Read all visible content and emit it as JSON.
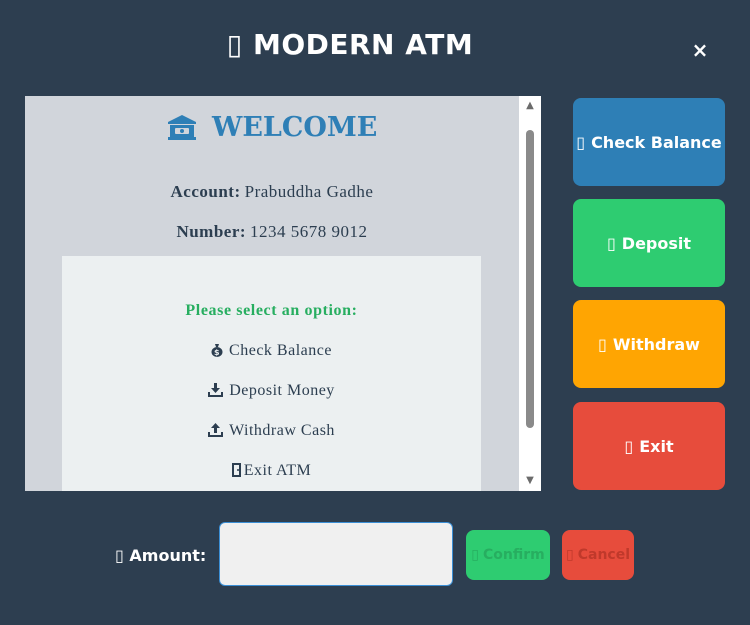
{
  "header": {
    "title": "▯ MODERN ATM",
    "close_label": "×"
  },
  "screen": {
    "welcome": "WELCOME",
    "account_label": "Account:",
    "account_value": "Prabuddha Gadhe",
    "number_label": "Number:",
    "number_value": "1234 5678 9012",
    "prompt": "Please select an option:",
    "options": [
      {
        "icon": "money-bag-icon",
        "label": "Check Balance"
      },
      {
        "icon": "download-icon",
        "label": "Deposit Money"
      },
      {
        "icon": "upload-icon",
        "label": "Withdraw Cash"
      },
      {
        "icon": "door-icon",
        "label": "Exit ATM"
      }
    ]
  },
  "side_buttons": [
    {
      "glyph": "▯",
      "label": "Check Balance",
      "color": "#2e7fb6"
    },
    {
      "glyph": "▯",
      "label": "Deposit",
      "color": "#2ecc71"
    },
    {
      "glyph": "▯",
      "label": "Withdraw",
      "color": "#ffa502"
    },
    {
      "glyph": "▯",
      "label": "Exit",
      "color": "#e74c3c"
    }
  ],
  "amount": {
    "glyph": "▯",
    "label": "Amount:",
    "value": "",
    "placeholder": ""
  },
  "confirm": {
    "glyph": "▯",
    "label": "Confirm",
    "color": "#2ecc71"
  },
  "cancel": {
    "glyph": "▯",
    "label": "Cancel",
    "color": "#e74c3c"
  },
  "colors": {
    "background": "#2d3e50",
    "screen": "#d1d5db",
    "panel": "#ecf0f1",
    "accent": "#2e7fb6",
    "prompt": "#27ae60"
  }
}
